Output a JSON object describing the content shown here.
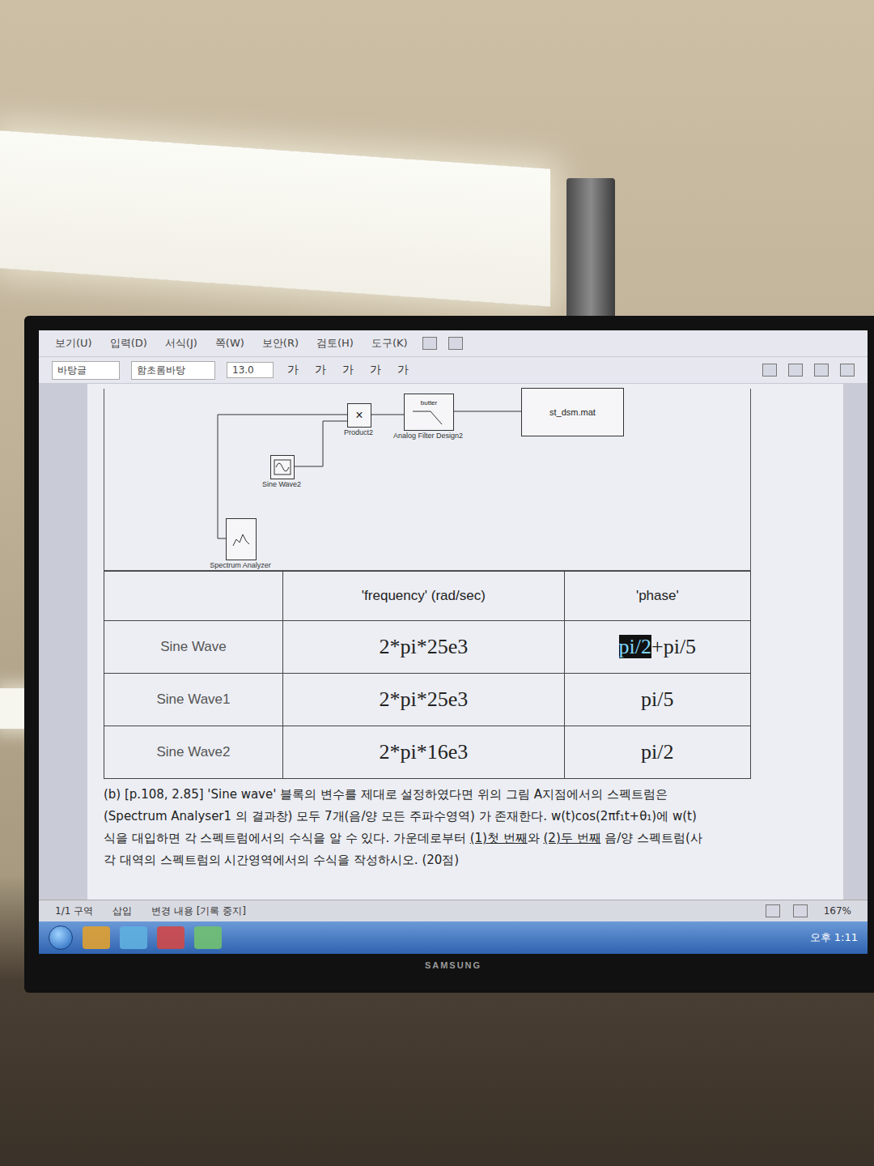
{
  "scene": {
    "brand": "SAMSUNG"
  },
  "window": {
    "menu": [
      "보기(U)",
      "입력(D)",
      "서식(J)",
      "쪽(W)",
      "보안(R)",
      "검토(H)",
      "도구(K)"
    ],
    "style_field": "바탕글",
    "font_field": "함초롬바탕",
    "size_field": "13.0",
    "format_buttons": [
      "가",
      "가",
      "가",
      "가",
      "가"
    ]
  },
  "diagram": {
    "blocks": [
      {
        "kind": "product",
        "label": "Product2",
        "symbol": "×"
      },
      {
        "kind": "filter",
        "label": "Analog Filter Design2",
        "symbol": "butter"
      },
      {
        "kind": "file",
        "symbol": "st_dsm.mat"
      },
      {
        "kind": "sine",
        "label": "Sine Wave2"
      },
      {
        "kind": "scope",
        "label": "Spectrum Analyzer"
      }
    ]
  },
  "table": {
    "columns": [
      "",
      "'frequency' (rad/sec)",
      "'phase'"
    ],
    "rows": [
      {
        "name": "Sine Wave",
        "frequency": "2*pi*25e3",
        "phase": [
          {
            "text": "pi/2",
            "selected": true
          },
          {
            "text": "+pi/5",
            "selected": false
          }
        ]
      },
      {
        "name": "Sine Wave1",
        "frequency": "2*pi*25e3",
        "phase": [
          {
            "text": "pi/5",
            "selected": false
          }
        ]
      },
      {
        "name": "Sine Wave2",
        "frequency": "2*pi*16e3",
        "phase": [
          {
            "text": "pi/2",
            "selected": false
          }
        ]
      }
    ]
  },
  "paragraph": [
    [
      {
        "text": "(b) [p.108, 2.85] 'Sine wave' 블록의 변수를 제대로 설정하였다면 위의 그림 A지점에서의 스펙트럼은",
        "underline": false
      }
    ],
    [
      {
        "text": "(Spectrum Analyser1 의 결과창) 모두 7개(음/양 모든 주파수영역) 가 존재한다. w(t)cos(2πf₁t+θ₁)에 w(t)",
        "underline": false
      }
    ],
    [
      {
        "text": "식을 대입하면 각 스펙트럼에서의 수식을 알 수 있다. 가운데로부터 ",
        "underline": false
      },
      {
        "text": "(1)첫 번째",
        "underline": true
      },
      {
        "text": "와 ",
        "underline": false
      },
      {
        "text": "(2)두 번째",
        "underline": true
      },
      {
        "text": " 음/양 스펙트럼(사",
        "underline": false
      }
    ],
    [
      {
        "text": "각 대역의 스펙트럼의 시간영역에서의 수식을 작성하시오. (20점)",
        "underline": false
      }
    ]
  ],
  "status_bar": {
    "items": [
      "1/1 구역",
      "삽입",
      "변경 내용 [기록 중지]"
    ],
    "zoom": "167%"
  },
  "taskbar": {
    "time": "오후 1:11"
  }
}
